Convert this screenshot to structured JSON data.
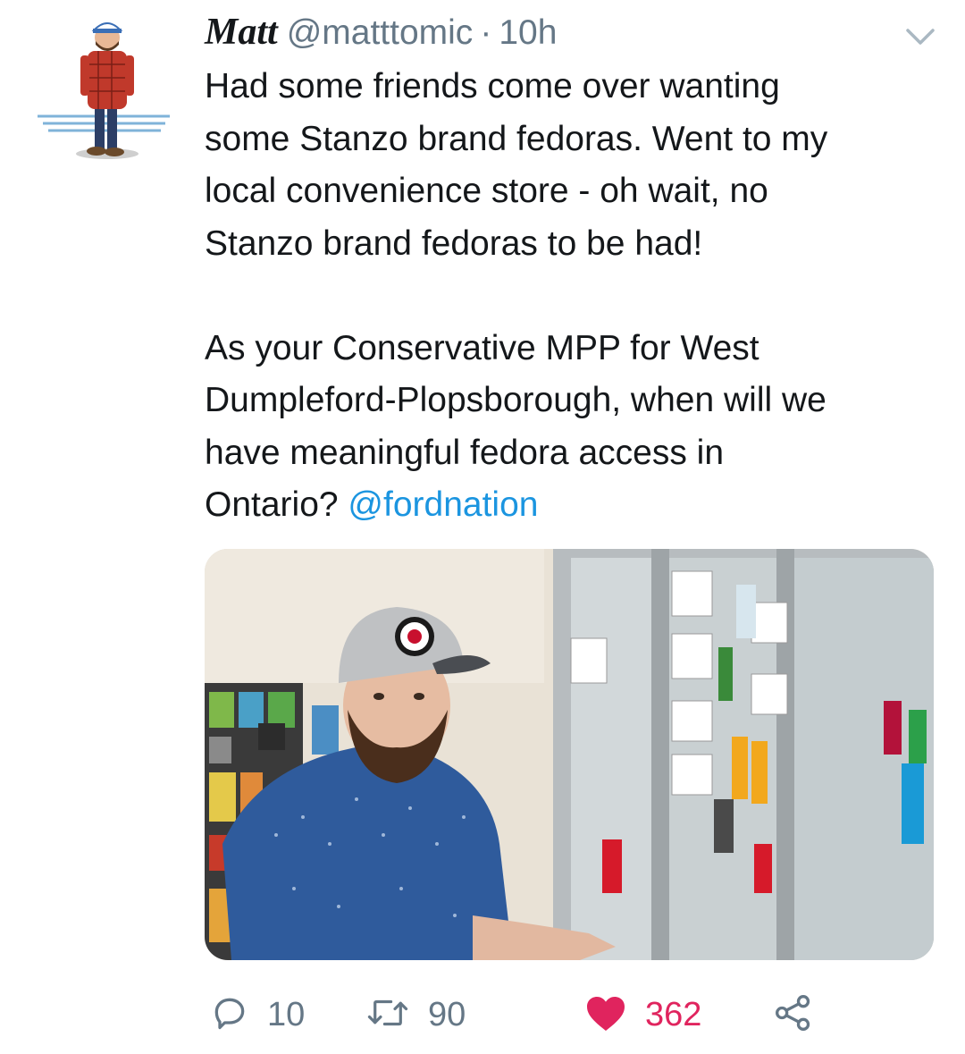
{
  "tweet": {
    "author_name": "Matt",
    "handle": "@matttomic",
    "separator": "·",
    "time": "10h",
    "body": {
      "line_1": "Had some friends come over wanting",
      "line_2": "some Stanzo brand fedoras. Went to my",
      "line_3": "local convenience store - oh wait, no",
      "line_4": "Stanzo brand fedoras to be had!",
      "line_5": "As your Conservative MPP for West",
      "line_6": "Dumpleford-Plopsborough, when will we",
      "line_7": "have meaningful fedora access in",
      "line_8_text": "Ontario? ",
      "mention": "@fordnation"
    },
    "actions": {
      "reply_count": "10",
      "retweet_count": "90",
      "like_count": "362"
    },
    "colors": {
      "text": "#14171a",
      "secondary": "#657786",
      "link": "#1b95e0",
      "like": "#e0245e"
    },
    "icons": {
      "reply": "reply-icon",
      "retweet": "retweet-icon",
      "like": "heart-icon",
      "share": "share-icon",
      "menu": "chevron-down-icon"
    }
  }
}
